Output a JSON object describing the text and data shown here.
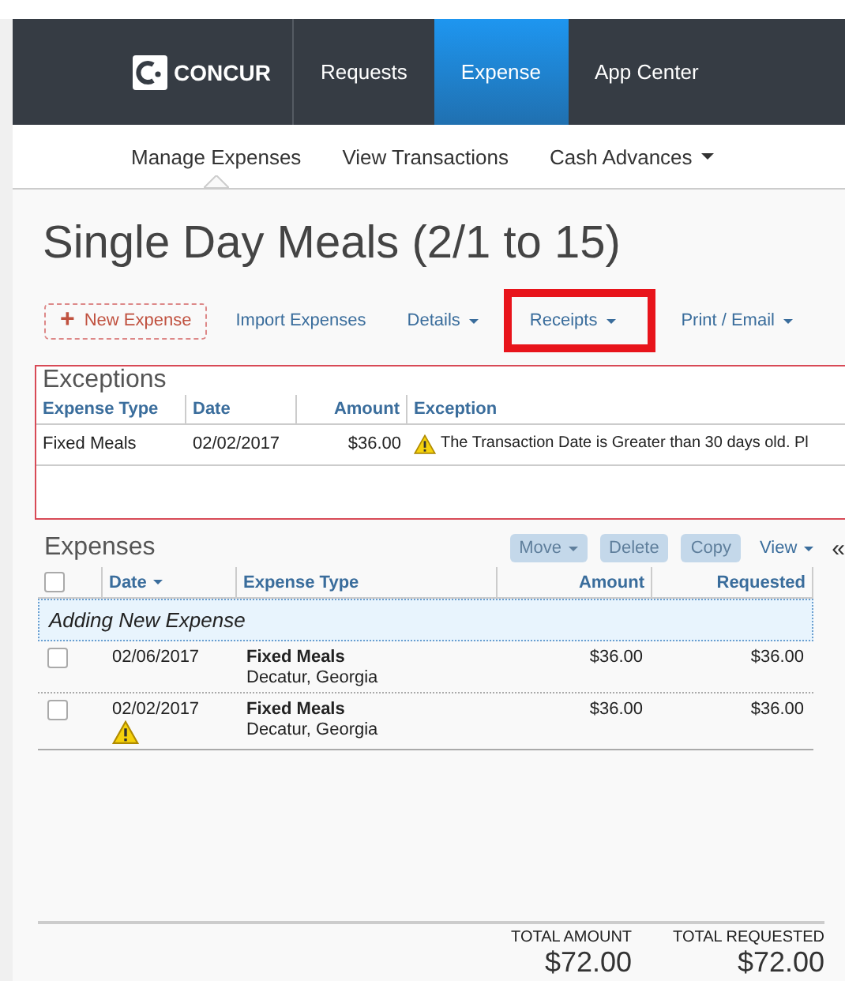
{
  "header": {
    "logo": "CONCUR",
    "nav": [
      {
        "label": "Requests",
        "selected": false
      },
      {
        "label": "Expense",
        "selected": true
      },
      {
        "label": "App Center",
        "selected": false
      }
    ]
  },
  "subnav": [
    {
      "label": "Manage Expenses",
      "selected": true,
      "dropdown": false
    },
    {
      "label": "View Transactions",
      "selected": false,
      "dropdown": false
    },
    {
      "label": "Cash Advances",
      "selected": false,
      "dropdown": true
    }
  ],
  "title": "Single Day Meals (2/1 to 15)",
  "toolbar": [
    {
      "kind": "primary",
      "label": "New Expense",
      "icon": "+",
      "dropdown": false,
      "highlighted": false
    },
    {
      "kind": "link",
      "label": "Import Expenses",
      "dropdown": false,
      "highlighted": false
    },
    {
      "kind": "link",
      "label": "Details",
      "dropdown": true,
      "highlighted": false
    },
    {
      "kind": "link",
      "label": "Receipts",
      "dropdown": true,
      "highlighted": true
    },
    {
      "kind": "link",
      "label": "Print / Email",
      "dropdown": true,
      "highlighted": false
    }
  ],
  "exceptions": {
    "title": "Exceptions",
    "columns": [
      "Expense Type",
      "Date",
      "Amount",
      "Exception"
    ],
    "rows": [
      {
        "expense_type": "Fixed Meals",
        "date": "02/02/2017",
        "amount": "$36.00",
        "exception": "The Transaction Date is Greater than 30 days old. Pl",
        "warning": true
      }
    ]
  },
  "expenses": {
    "title": "Expenses",
    "actions": [
      {
        "label": "Move",
        "dropdown": true,
        "disabled": true
      },
      {
        "label": "Delete",
        "dropdown": false,
        "disabled": true
      },
      {
        "label": "Copy",
        "dropdown": false,
        "disabled": true
      }
    ],
    "view": "View",
    "collapse": "«",
    "columns": [
      {
        "label": "Date",
        "sorted": true
      },
      {
        "label": "Expense Type",
        "sorted": false
      },
      {
        "label": "Amount",
        "sorted": false
      },
      {
        "label": "Requested",
        "sorted": false
      }
    ],
    "adding_row": "Adding New Expense",
    "select_all_checked": false,
    "rows": [
      {
        "checked": false,
        "date": "02/06/2017",
        "warning": false,
        "expense_type": "Fixed Meals",
        "location": "Decatur, Georgia",
        "amount": "$36.00",
        "requested": "$36.00"
      },
      {
        "checked": false,
        "date": "02/02/2017",
        "warning": true,
        "expense_type": "Fixed Meals",
        "location": "Decatur, Georgia",
        "amount": "$36.00",
        "requested": "$36.00"
      }
    ]
  },
  "totals": [
    {
      "label": "TOTAL AMOUNT",
      "value": "$72.00"
    },
    {
      "label": "TOTAL REQUESTED",
      "value": "$72.00"
    }
  ]
}
